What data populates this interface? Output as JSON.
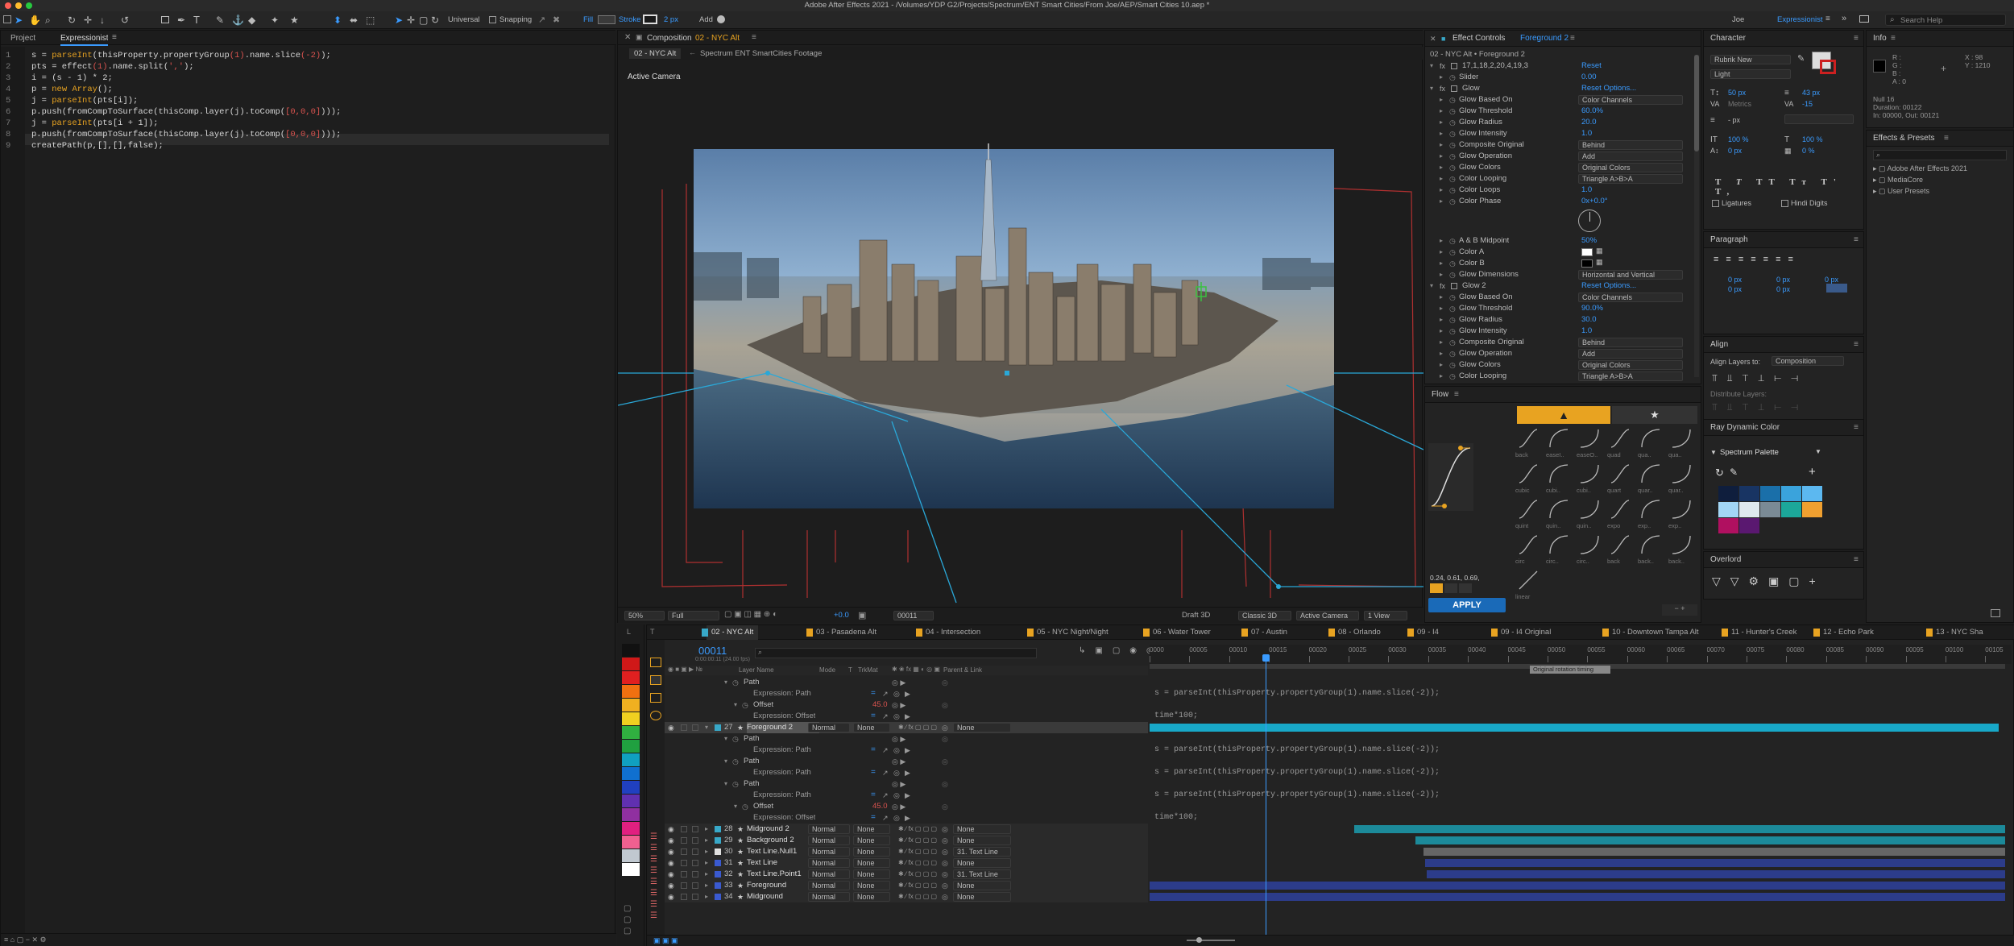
{
  "app": {
    "title": "Adobe After Effects 2021 - /Volumes/YDP G2/Projects/Spectrum/ENT Smart Cities/From Joe/AEP/Smart Cities 10.aep *"
  },
  "toolbar": {
    "universal": "Universal",
    "snapping": "Snapping",
    "fill": "Fill",
    "stroke": "Stroke",
    "stroke_px": "2 px",
    "add": "Add",
    "user": "Joe",
    "workspace": "Expressionist",
    "search_placeholder": "Search Help"
  },
  "left_panel": {
    "tabs": [
      "Project",
      "Expressionist"
    ],
    "code_lines": [
      "s = parseInt(thisProperty.propertyGroup(1).name.slice(-2));",
      "pts = effect(1).name.split(',');",
      "i = (s - 1) * 2;",
      "p = new Array();",
      "j = parseInt(pts[i]);",
      "p.push(fromCompToSurface(thisComp.layer(j).toComp([0,0,0])));",
      "j = parseInt(pts[i + 1]);",
      "p.push(fromCompToSurface(thisComp.layer(j).toComp([0,0,0])));",
      "createPath(p,[],[],false);"
    ]
  },
  "composition": {
    "tab_prefix": "Composition",
    "tab_name": "02 - NYC Alt",
    "subtab_active": "02 - NYC Alt",
    "subtab_other": "Spectrum ENT SmartCities Footage",
    "camera_label": "Active Camera",
    "zoom": "50%",
    "resolution": "Full",
    "exposure": "+0.0",
    "timecode": "00011",
    "renderer": "Draft 3D",
    "renderer_mode": "Classic 3D",
    "camera": "Active Camera",
    "view": "1 View"
  },
  "effect_controls": {
    "title": "Effect Controls",
    "layer": "Foreground 2",
    "breadcrumb": "02 - NYC Alt • Foreground 2",
    "rows": [
      {
        "name": "17,1,18,2,20,4,19,3",
        "value": "Reset",
        "fx": true
      },
      {
        "name": "Slider",
        "value": "0.00"
      },
      {
        "name": "Glow",
        "value": "Reset   Options...",
        "fx": true
      },
      {
        "name": "Glow Based On",
        "value": "Color Channels",
        "dd": true
      },
      {
        "name": "Glow Threshold",
        "value": "60.0%"
      },
      {
        "name": "Glow Radius",
        "value": "20.0"
      },
      {
        "name": "Glow Intensity",
        "value": "1.0"
      },
      {
        "name": "Composite Original",
        "value": "Behind",
        "dd": true
      },
      {
        "name": "Glow Operation",
        "value": "Add",
        "dd": true
      },
      {
        "name": "Glow Colors",
        "value": "Original Colors",
        "dd": true
      },
      {
        "name": "Color Looping",
        "value": "Triangle A>B>A",
        "dd": true
      },
      {
        "name": "Color Loops",
        "value": "1.0"
      },
      {
        "name": "Color Phase",
        "value": "0x+0.0°"
      }
    ],
    "rows2": [
      {
        "name": "A & B Midpoint",
        "value": "50%"
      },
      {
        "name": "Color A",
        "value": ""
      },
      {
        "name": "Color B",
        "value": ""
      },
      {
        "name": "Glow Dimensions",
        "value": "Horizontal and Vertical",
        "dd": true
      },
      {
        "name": "Glow 2",
        "value": "Reset   Options...",
        "fx": true
      },
      {
        "name": "Glow Based On",
        "value": "Color Channels",
        "dd": true
      },
      {
        "name": "Glow Threshold",
        "value": "90.0%"
      },
      {
        "name": "Glow Radius",
        "value": "30.0"
      },
      {
        "name": "Glow Intensity",
        "value": "1.0"
      },
      {
        "name": "Composite Original",
        "value": "Behind",
        "dd": true
      },
      {
        "name": "Glow Operation",
        "value": "Add",
        "dd": true
      },
      {
        "name": "Glow Colors",
        "value": "Original Colors",
        "dd": true
      },
      {
        "name": "Color Looping",
        "value": "Triangle A>B>A",
        "dd": true
      }
    ]
  },
  "flow": {
    "title": "Flow",
    "bezier": "0.24, 0.61, 0.69,",
    "apply": "APPLY",
    "presets": [
      "back",
      "easeI..",
      "easeO..",
      "quad",
      "qua..",
      "qua..",
      "cubic",
      "cubi..",
      "cubi..",
      "quart",
      "quar..",
      "quar..",
      "quint",
      "quin..",
      "quin..",
      "expo",
      "exp..",
      "exp..",
      "circ",
      "circ..",
      "circ..",
      "back",
      "back..",
      "back..",
      "linear"
    ]
  },
  "character": {
    "title": "Character",
    "font": "Rubrik New",
    "style": "Light",
    "size": "50 px",
    "leading": "43 px",
    "kerning": "Metrics",
    "tracking": "-15",
    "stroke": "- px",
    "vscale": "100 %",
    "hscale": "100 %",
    "baseline": "0 px",
    "tsume": "0 %",
    "ligatures": "Ligatures",
    "hindi": "Hindi Digits"
  },
  "paragraph": {
    "title": "Paragraph",
    "values": [
      "0 px",
      "0 px",
      "0 px",
      "0 px",
      "0 px"
    ]
  },
  "align": {
    "title": "Align",
    "label": "Align Layers to:",
    "target": "Composition",
    "distribute": "Distribute Layers:"
  },
  "ray_dynamic": {
    "title": "Ray Dynamic Color",
    "palette": "Spectrum Palette",
    "colors": [
      "#0f1e3d",
      "#183463",
      "#1a6fa9",
      "#3aa3dc",
      "#5cb8f0",
      "#a3d6f5",
      "#dfe8ee",
      "#7a8a95",
      "#1ca79a",
      "#f0a030",
      "#b01060",
      "#5a1870"
    ]
  },
  "overlord": {
    "title": "Overlord"
  },
  "info": {
    "title": "Info",
    "r": "R :",
    "g": "G :",
    "b": "B :",
    "a": "A : 0",
    "x": "X : 98",
    "y": "Y : 1210",
    "layer": "Null 16",
    "duration": "Duration: 00122",
    "inout": "In: 00000, Out: 00121"
  },
  "effects_presets": {
    "title": "Effects & Presets",
    "items": [
      "Adobe After Effects 2021",
      "MediaCore",
      "User Presets"
    ]
  },
  "timeline": {
    "tabs": [
      "02 - NYC Alt",
      "03 - Pasadena Alt",
      "04 - Intersection",
      "05 - NYC Night/Night",
      "06 - Water Tower",
      "07 - Austin",
      "08 - Orlando",
      "09 - I4",
      "09 - I4 Original",
      "10 - Downtown Tampa Alt",
      "11 - Hunter's Creek",
      "12 - Echo Park",
      "13 - NYC Sha"
    ],
    "timecode": "00011",
    "timecode_sub": "0:00:00:11 (24.00 fps)",
    "columns": {
      "layer_name": "Layer Name",
      "mode": "Mode",
      "t": "T",
      "trkmat": "TrkMat",
      "parent": "Parent & Link"
    },
    "ruler": [
      "0000",
      "00005",
      "00010",
      "00015",
      "00020",
      "00025",
      "00030",
      "00035",
      "00040",
      "00045",
      "00050",
      "00055",
      "00060",
      "00065",
      "00070",
      "00075",
      "00080",
      "00085",
      "00090",
      "00095",
      "00100",
      "00105"
    ],
    "marker": "Original rotation timing",
    "rows": [
      {
        "type": "prop",
        "name": "Path",
        "indent": 1
      },
      {
        "type": "expr",
        "name": "Expression: Path",
        "text": "s = parseInt(thisProperty.propertyGroup(1).name.slice(-2));"
      },
      {
        "type": "prop",
        "name": "Offset",
        "value": "45.0",
        "indent": 2
      },
      {
        "type": "expr",
        "name": "Expression: Offset",
        "text": "time*100;"
      },
      {
        "type": "layer",
        "num": "27",
        "name": "Foreground 2",
        "mode": "Normal",
        "trk": "None",
        "parent": "None",
        "color": "#38a8c8",
        "selected": true
      },
      {
        "type": "prop",
        "name": "Path",
        "indent": 1
      },
      {
        "type": "expr",
        "name": "Expression: Path",
        "text": "s = parseInt(thisProperty.propertyGroup(1).name.slice(-2));"
      },
      {
        "type": "prop",
        "name": "Path",
        "indent": 1
      },
      {
        "type": "expr",
        "name": "Expression: Path",
        "text": "s = parseInt(thisProperty.propertyGroup(1).name.slice(-2));"
      },
      {
        "type": "prop",
        "name": "Path",
        "indent": 1
      },
      {
        "type": "expr",
        "name": "Expression: Path",
        "text": "s = parseInt(thisProperty.propertyGroup(1).name.slice(-2));"
      },
      {
        "type": "prop",
        "name": "Offset",
        "value": "45.0",
        "indent": 2
      },
      {
        "type": "expr",
        "name": "Expression: Offset",
        "text": "time*100;"
      },
      {
        "type": "layer",
        "num": "28",
        "name": "Midground 2",
        "mode": "Normal",
        "trk": "None",
        "parent": "None",
        "color": "#38a8c8"
      },
      {
        "type": "layer",
        "num": "29",
        "name": "Background 2",
        "mode": "Normal",
        "trk": "None",
        "parent": "None",
        "color": "#38a8c8"
      },
      {
        "type": "layer",
        "num": "30",
        "name": "Text Line.Null1",
        "mode": "Normal",
        "trk": "None",
        "parent": "31. Text Line",
        "color": "#e0e0e0"
      },
      {
        "type": "layer",
        "num": "31",
        "name": "Text Line",
        "mode": "Normal",
        "trk": "None",
        "parent": "None",
        "color": "#3a5ad0"
      },
      {
        "type": "layer",
        "num": "32",
        "name": "Text Line.Point1",
        "mode": "Normal",
        "trk": "None",
        "parent": "31. Text Line",
        "color": "#3a5ad0"
      },
      {
        "type": "layer",
        "num": "33",
        "name": "Foreground",
        "mode": "Normal",
        "trk": "None",
        "parent": "None",
        "color": "#3a5ad0"
      },
      {
        "type": "layer",
        "num": "34",
        "name": "Midground",
        "mode": "Normal",
        "trk": "None",
        "parent": "None",
        "color": "#3a5ad0"
      }
    ]
  },
  "label_colors": [
    "#111111",
    "#d01818",
    "#e02020",
    "#f07010",
    "#f0b020",
    "#f0d020",
    "#30b040",
    "#20a040",
    "#10a0c0",
    "#1070d0",
    "#2040c0",
    "#6030b0",
    "#9030a0",
    "#e02080",
    "#f06090",
    "#c0c8d0",
    "#ffffff"
  ]
}
